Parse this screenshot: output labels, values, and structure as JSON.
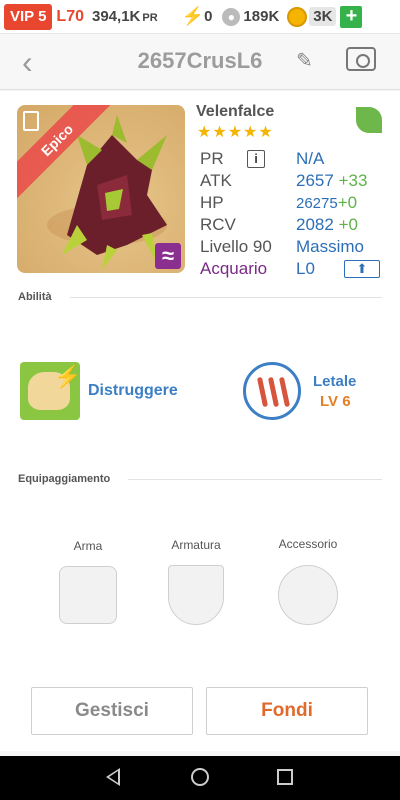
{
  "statusbar": {
    "vip": "VIP 5",
    "level": "L70",
    "power": "394,1K",
    "power_unit": "PR",
    "energy": "0",
    "paw_currency": "189K",
    "coins": "3K",
    "plus_label": "+"
  },
  "header": {
    "title": "2657CrusL6"
  },
  "monster": {
    "rarity": "Epico",
    "name": "Velenfalce",
    "stars": "★★★★★",
    "stats": [
      {
        "label": "PR",
        "value": "N/A",
        "bonus": ""
      },
      {
        "label": "ATK",
        "value": "2657",
        "bonus": "+33"
      },
      {
        "label": "HP",
        "value": "26275",
        "bonus": "+0"
      },
      {
        "label": "RCV",
        "value": "2082",
        "bonus": "+0"
      },
      {
        "label": "Livello 90",
        "value": "Massimo",
        "bonus": ""
      },
      {
        "label": "Acquario",
        "value": "L0",
        "bonus": ""
      }
    ]
  },
  "sections": {
    "ability": "Abilità",
    "equipment": "Equipaggiamento"
  },
  "skill": {
    "name": "Distruggere"
  },
  "trait": {
    "name": "Letale",
    "level": "LV 6"
  },
  "equipment": {
    "slots": [
      "Arma",
      "Armatura",
      "Accessorio"
    ]
  },
  "buttons": {
    "manage": "Gestisci",
    "fuse": "Fondi"
  },
  "colors": {
    "accent_red": "#e8462f",
    "stat_blue": "#2d6fb7",
    "bonus_green": "#5fb34b",
    "aquarium_purple": "#7a2a86",
    "fuse_orange": "#e06a2b"
  }
}
